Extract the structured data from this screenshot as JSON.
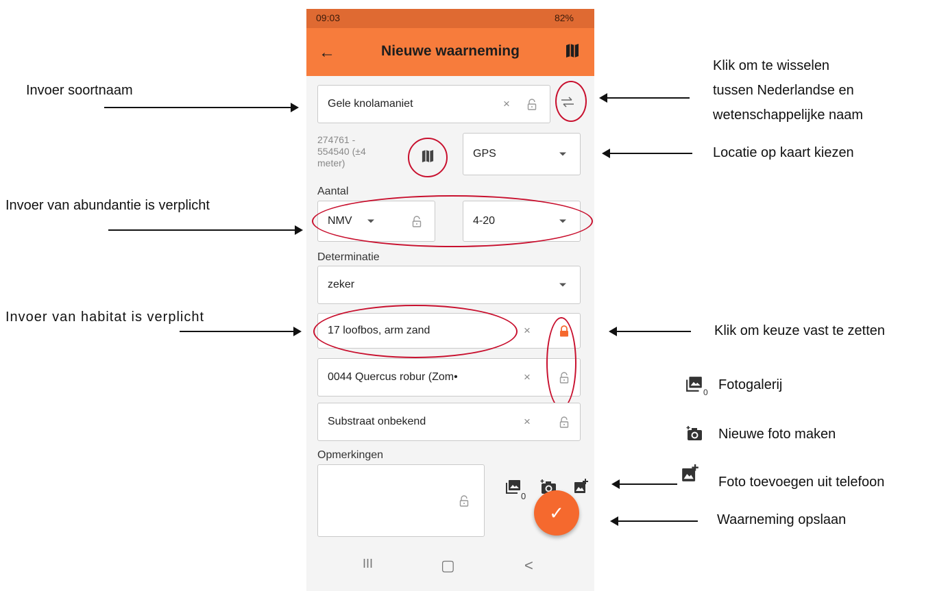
{
  "status": {
    "time": "09:03",
    "battery": "82%"
  },
  "appbar": {
    "title": "Nieuwe waarneming",
    "back_icon": "arrow-left-icon",
    "map_icon": "map-icon"
  },
  "form": {
    "species": {
      "value": "Gele knolamaniet",
      "clear": "×"
    },
    "coords": {
      "line1": "274761 -",
      "line2": "554540 (±4",
      "line3": "meter)"
    },
    "location": {
      "value": "GPS"
    },
    "abundance_label": "Aantal",
    "abundance": {
      "method": "NMV",
      "value": "4-20"
    },
    "determination_label": "Determinatie",
    "determination": {
      "value": "zeker"
    },
    "habitat": {
      "value": "17 loofbos, arm zand",
      "clear": "×"
    },
    "host": {
      "value": "0044 Quercus robur (Zom•",
      "clear": "×"
    },
    "substrate": {
      "value": "Substraat onbekend",
      "clear": "×"
    },
    "remarks_label": "Opmerkingen",
    "photo_count": "0"
  },
  "fab": {
    "icon": "checkmark-icon",
    "label": "✓"
  },
  "navbar": {
    "recent": "III",
    "home": "▢",
    "back": "<"
  },
  "annotations": {
    "species_input": "Invoer soortnaam",
    "toggle_name": [
      "Klik om te wisselen",
      "tussen Nederlandse en",
      "wetenschappelijke naam"
    ],
    "location": "Locatie op kaart kiezen",
    "abundance": "Invoer van abundantie is verplicht",
    "habitat": "Invoer van habitat is verplicht",
    "lock": "Klik om keuze vast te zetten",
    "gallery": "Fotogalerij",
    "gallery_sub": "0",
    "new_photo": "Nieuwe foto maken",
    "add_photo": "Foto toevoegen uit telefoon",
    "save": "Waarneming opslaan"
  },
  "colors": {
    "appbar": "#f77c3c",
    "statusbar": "#df6a32",
    "fab": "#f5692e",
    "lock_active": "#f5692e",
    "circle": "#c8102e"
  }
}
